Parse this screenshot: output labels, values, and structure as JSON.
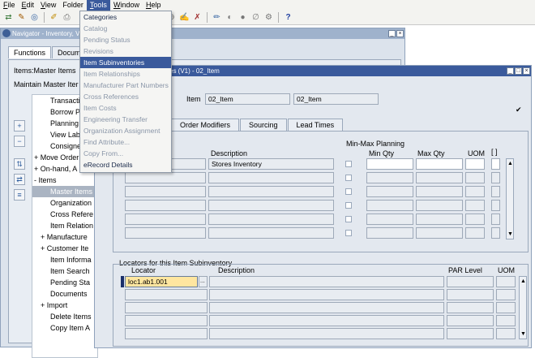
{
  "menubar": [
    "File",
    "Edit",
    "View",
    "Folder",
    "Tools",
    "Window",
    "Help"
  ],
  "menubar_active": "Tools",
  "toolbar": {
    "help_label": "?"
  },
  "navigator": {
    "title": "Navigator - Inventory, Vis",
    "tabs": [
      "Functions",
      "Docum"
    ],
    "header_items": "Items:Master Items",
    "header_maintain": "Maintain Master Iter",
    "tree": [
      "Transacti",
      "Borrow P",
      "Planning",
      "View Lab",
      "Consigne",
      "+ Move Order",
      "+ On-hand, A",
      "- Items",
      "Master Items",
      "Organization",
      "Cross Refere",
      "Item Relation",
      "+ Manufacture",
      "+ Customer Ite",
      "Item Informa",
      "Item Search",
      "Pending Sta",
      "Documents",
      "+ Import",
      "Delete Items",
      "Copy Item A"
    ],
    "tree_selected": 8
  },
  "tools_menu": [
    {
      "label": "Categories",
      "enabled": true
    },
    {
      "label": "Catalog",
      "enabled": false
    },
    {
      "label": "Pending Status",
      "enabled": false
    },
    {
      "label": "Revisions",
      "enabled": false
    },
    {
      "label": "Item Subinventories",
      "enabled": true,
      "highlighted": true
    },
    {
      "label": "Item Relationships",
      "enabled": false
    },
    {
      "label": "Manufacturer Part Numbers",
      "enabled": false
    },
    {
      "label": "Cross References",
      "enabled": false
    },
    {
      "label": "Item Costs",
      "enabled": false
    },
    {
      "label": "Engineering Transfer",
      "enabled": false
    },
    {
      "label": "Organization Assignment",
      "enabled": false
    },
    {
      "label": "Find Attribute...",
      "enabled": false
    },
    {
      "label": "Copy From...",
      "enabled": false
    },
    {
      "label": "eRecord Details",
      "enabled": true
    }
  ],
  "stores": {
    "title": "es (V1) - 02_Item",
    "item_label": "Item",
    "item_value": "02_Item",
    "item_desc": "02_Item",
    "tabs": [
      "Order Modifiers",
      "Sourcing",
      "Lead Times"
    ],
    "minmax_header": "Min-Max Planning",
    "col_description": "Description",
    "col_min": "Min Qty",
    "col_max": "Max Qty",
    "col_uom": "UOM",
    "col_bracket": "[ ]",
    "row1_desc": "Stores Inventory",
    "locators_title": "Locators for this Item Subinventory",
    "loc_col_locator": "Locator",
    "loc_col_desc": "Description",
    "loc_col_par": "PAR Level",
    "loc_col_uom": "UOM",
    "loc_row1": "loc1.ab1.001",
    "loc_lov": "..."
  }
}
